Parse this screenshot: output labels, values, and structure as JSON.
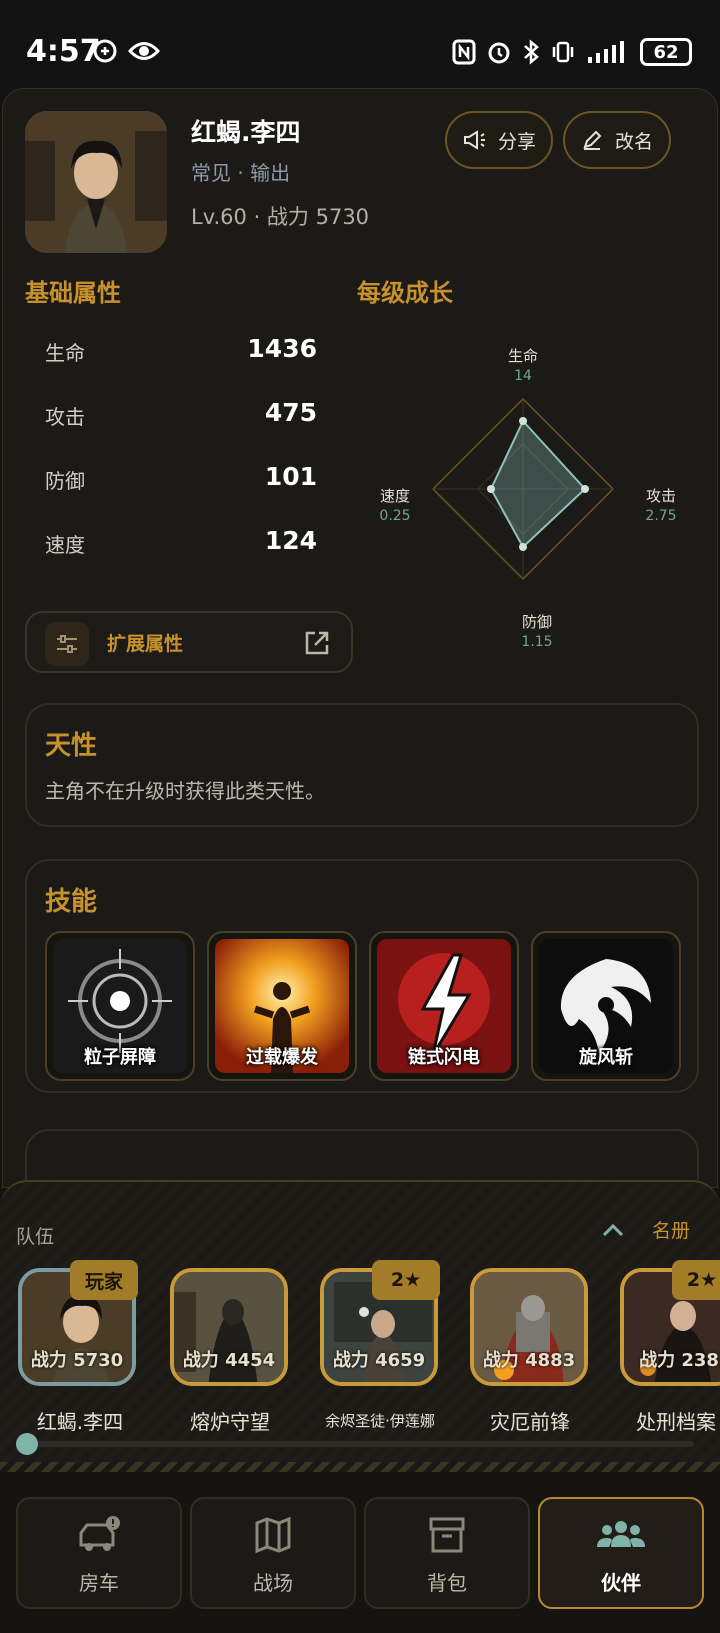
{
  "status_bar": {
    "time": "4:57",
    "battery": "62"
  },
  "hero": {
    "name": "红蝎.李四",
    "type_line": "常见 · 输出",
    "level_line": "Lv.60 · 战力 5730",
    "share_label": "分享",
    "rename_label": "改名"
  },
  "base_attrs": {
    "title": "基础属性",
    "items": [
      {
        "label": "生命",
        "value": "1436"
      },
      {
        "label": "攻击",
        "value": "475"
      },
      {
        "label": "防御",
        "value": "101"
      },
      {
        "label": "速度",
        "value": "124"
      }
    ],
    "extended_label": "扩展属性"
  },
  "growth": {
    "title": "每级成长",
    "axes": [
      {
        "label": "生命",
        "value": "14"
      },
      {
        "label": "攻击",
        "value": "2.75"
      },
      {
        "label": "防御",
        "value": "1.15"
      },
      {
        "label": "速度",
        "value": "0.25"
      }
    ]
  },
  "trait": {
    "title": "天性",
    "text": "主角不在升级时获得此类天性。"
  },
  "skills": {
    "title": "技能",
    "items": [
      {
        "label": "粒子屏障"
      },
      {
        "label": "过载爆发"
      },
      {
        "label": "链式闪电"
      },
      {
        "label": "旋风斩"
      }
    ]
  },
  "team": {
    "label": "队伍",
    "roster_label": "名册",
    "player_tag": "玩家",
    "members": [
      {
        "name": "红蝎.李四",
        "power": "战力 5730",
        "stars": ""
      },
      {
        "name": "熔炉守望",
        "power": "战力 4454",
        "stars": ""
      },
      {
        "name": "余烬圣徒·伊莲娜",
        "power": "战力 4659",
        "stars": "2★"
      },
      {
        "name": "灾厄前锋",
        "power": "战力 4883",
        "stars": ""
      },
      {
        "name": "处刑档案",
        "power": "战力 238",
        "stars": "2★"
      }
    ]
  },
  "nav": {
    "items": [
      {
        "label": "房车",
        "icon": "rv-car-icon"
      },
      {
        "label": "战场",
        "icon": "map-icon"
      },
      {
        "label": "背包",
        "icon": "archive-box-icon"
      },
      {
        "label": "伙伴",
        "icon": "group-icon"
      }
    ],
    "active": "伙伴"
  },
  "colors": {
    "accent": "#c7922c",
    "teal": "#7fb2a8",
    "bg": "#121212"
  }
}
